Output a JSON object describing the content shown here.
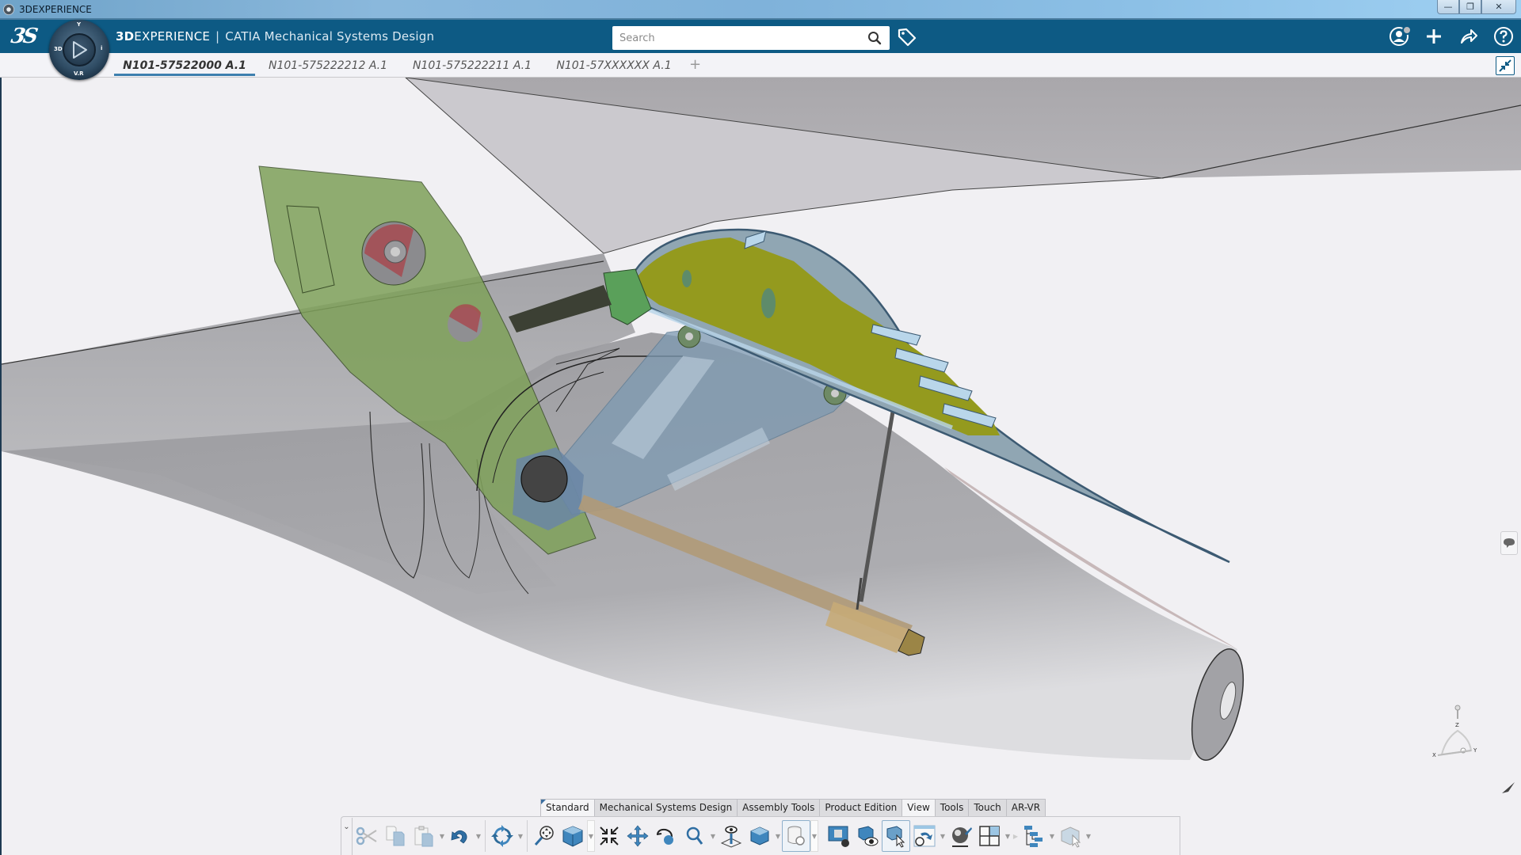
{
  "window": {
    "title": "3DEXPERIENCE",
    "controls": [
      "minimize",
      "restore",
      "close"
    ]
  },
  "header": {
    "brand_bold": "3D",
    "brand_rest": "EXPERIENCE",
    "separator": "|",
    "product_brand": "CATIA",
    "product_name": "Mechanical Systems Design",
    "search_placeholder": "Search",
    "search_value": "",
    "icons": [
      "user-profile-icon",
      "add-icon",
      "share-icon",
      "help-icon"
    ],
    "accent_color": "#0d5a84"
  },
  "compass": {
    "labels": {
      "left": "3D",
      "bottom": "V.R",
      "right": "i",
      "top": "Y"
    }
  },
  "tabs": [
    {
      "label": "N101-57522000 A.1",
      "active": true
    },
    {
      "label": "N101-575222212 A.1",
      "active": false
    },
    {
      "label": "N101-575222211 A.1",
      "active": false
    },
    {
      "label": "N101-57XXXXXX A.1",
      "active": false
    }
  ],
  "tab_add_label": "+",
  "viewport": {
    "triad_labels": {
      "x": "X",
      "y": "Y",
      "z": "Z"
    },
    "scene_colors": {
      "background": "#f1f0f3",
      "fairing": "#9a9a9e",
      "bracket_green": "#7f9f5a",
      "spar_blue": "#7f9cb4",
      "panel_yellow": "#949a1e",
      "skin_blue": "#90a6b3",
      "rod_tan": "#b09a78"
    }
  },
  "action_bar": {
    "tabs": [
      {
        "label": "Standard",
        "active": true
      },
      {
        "label": "Mechanical Systems Design",
        "active": false
      },
      {
        "label": "Assembly Tools",
        "active": false
      },
      {
        "label": "Product Edition",
        "active": false
      },
      {
        "label": "View",
        "active": false,
        "highlight": true
      },
      {
        "label": "Tools",
        "active": false
      },
      {
        "label": "Touch",
        "active": false
      },
      {
        "label": "AR-VR",
        "active": false
      }
    ],
    "tools": [
      "cut-icon",
      "copy-icon",
      "paste-icon",
      "undo-icon",
      "update-icon",
      "zoom-area-icon",
      "view-cube-icon",
      "fit-all-icon",
      "pan-icon",
      "rotate-icon",
      "zoom-icon",
      "look-at-icon",
      "render-style-icon",
      "visualization-options-icon",
      "display-settings-icon",
      "show-hide-icon",
      "swap-visible-icon",
      "restore-view-icon",
      "materials-icon",
      "multi-view-icon",
      "tree-icon",
      "select-icon"
    ]
  }
}
